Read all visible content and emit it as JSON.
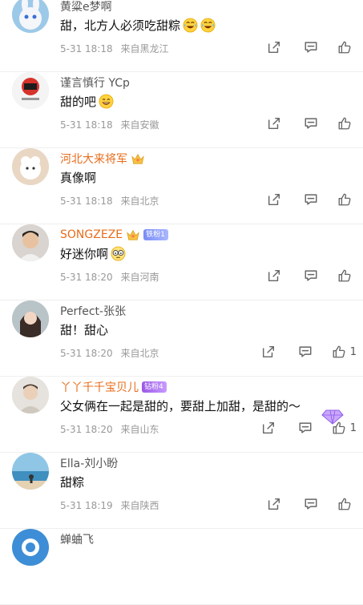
{
  "comments": [
    {
      "username": "黄粱e梦啊",
      "text": "甜，北方人必须吃甜粽",
      "emojis": [
        "laugh-cry-emoji",
        "laugh-cry-emoji"
      ],
      "date": "5-31 18:18",
      "location": "来自黑龙江",
      "likes": ""
    },
    {
      "username": "谨言慎行 YCp",
      "text": "甜的吧",
      "emojis": [
        "grin-emoji"
      ],
      "date": "5-31 18:18",
      "location": "来自安徽",
      "likes": ""
    },
    {
      "username": "河北大来将军",
      "text": "真像啊",
      "emojis": [],
      "date": "5-31 18:18",
      "location": "来自北京",
      "likes": ""
    },
    {
      "username": "SONGZEZE",
      "badge": "铁粉1",
      "text": "好迷你啊",
      "emojis": [
        "glasses-emoji"
      ],
      "date": "5-31 18:20",
      "location": "来自河南",
      "likes": ""
    },
    {
      "username": "Perfect-张张",
      "text": "甜！甜心",
      "emojis": [],
      "date": "5-31 18:20",
      "location": "来自北京",
      "likes": "1"
    },
    {
      "username": "丫丫千千宝贝儿",
      "badge": "钻粉4",
      "text": "父女俩在一起是甜的，要甜上加甜，是甜的～",
      "emojis": [],
      "date": "5-31 18:20",
      "location": "来自山东",
      "likes": "1"
    },
    {
      "username": "Ella-刘小盼",
      "text": "甜粽",
      "emojis": [],
      "date": "5-31 18:19",
      "location": "来自陕西",
      "likes": ""
    },
    {
      "username": "蝉蛐飞"
    }
  ],
  "icons": {
    "share": "share-icon",
    "reply": "comment-icon",
    "like": "thumbs-up-icon"
  },
  "colors": {
    "vip_name": "#e86c1b",
    "meta_text": "#999999",
    "fan_badge": "#7a8cf5",
    "diamond_badge": "#9b57e6"
  }
}
